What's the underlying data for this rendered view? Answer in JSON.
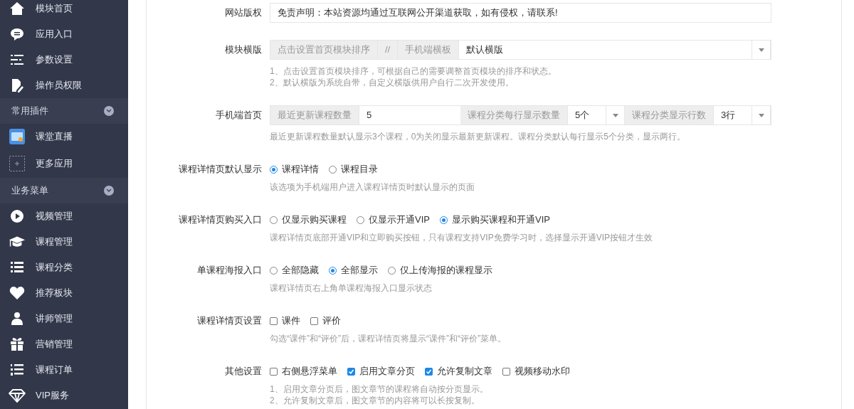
{
  "sidebar": [
    {
      "kind": "item",
      "label": "模块首页"
    },
    {
      "kind": "item",
      "label": "应用入口"
    },
    {
      "kind": "item",
      "label": "参数设置"
    },
    {
      "kind": "item",
      "label": "操作员权限"
    },
    {
      "kind": "section",
      "label": "常用插件",
      "expanded": true
    },
    {
      "kind": "item",
      "label": "课堂直播"
    },
    {
      "kind": "item",
      "label": "更多应用"
    },
    {
      "kind": "section",
      "label": "业务菜单",
      "expanded": true
    },
    {
      "kind": "item",
      "label": "视频管理"
    },
    {
      "kind": "item",
      "label": "课程管理"
    },
    {
      "kind": "item",
      "label": "课程分类"
    },
    {
      "kind": "item",
      "label": "推荐板块"
    },
    {
      "kind": "item",
      "label": "讲师管理"
    },
    {
      "kind": "item",
      "label": "营销管理"
    },
    {
      "kind": "item",
      "label": "课程订单"
    },
    {
      "kind": "item",
      "label": "VIP服务"
    }
  ],
  "form": [
    {
      "label": "网站版权",
      "controls": [
        {
          "kind": "text",
          "value": "免责声明：本站资源均通过互联网公开渠道获取，如有侵权，请联系!"
        }
      ]
    },
    {
      "label": "模块横版",
      "controls": [
        {
          "kind": "addon",
          "text": "点击设置首页模块排序"
        },
        {
          "kind": "addon",
          "text": "//"
        },
        {
          "kind": "addon",
          "text": "手机端横板"
        },
        {
          "kind": "select",
          "value": "默认横版"
        }
      ],
      "help": [
        "1、点击设置首页模块排序，可根据自己的需要调整首页模块的排序和状态。",
        "2、默认横版为系统自带，自定义横版供用户自行二次开发使用。"
      ]
    },
    {
      "label": "手机端首页",
      "controls": [
        {
          "kind": "addon",
          "text": "最近更新课程数量"
        },
        {
          "kind": "text",
          "value": "5"
        },
        {
          "kind": "addon",
          "text": "课程分类每行显示数量"
        },
        {
          "kind": "select",
          "value": "5个"
        },
        {
          "kind": "addon",
          "text": "课程分类显示行数"
        },
        {
          "kind": "select",
          "value": "3行"
        }
      ],
      "help": [
        "最近更新课程数量默认显示3个课程，0为关闭显示最新更新课程。课程分类默认每行显示5个分类，显示两行。"
      ]
    },
    {
      "label": "课程详情页默认显示",
      "controls": [
        {
          "kind": "radio",
          "text": "课程详情",
          "selected": true
        },
        {
          "kind": "radio",
          "text": "课程目录",
          "selected": false
        }
      ],
      "help": [
        "该选项为手机端用户进入课程详情页时默认显示的页面"
      ]
    },
    {
      "label": "课程详情页购买入口",
      "controls": [
        {
          "kind": "radio",
          "text": "仅显示购买课程",
          "selected": false
        },
        {
          "kind": "radio",
          "text": "仅显示开通VIP",
          "selected": false
        },
        {
          "kind": "radio",
          "text": "显示购买课程和开通VIP",
          "selected": true
        }
      ],
      "help": [
        "课程详情页底部开通VIP和立即购买按钮，只有课程支持VIP免费学习时，选择显示开通VIP按钮才生效"
      ]
    },
    {
      "label": "单课程海报入口",
      "controls": [
        {
          "kind": "radio",
          "text": "全部隐藏",
          "selected": false
        },
        {
          "kind": "radio",
          "text": "全部显示",
          "selected": true
        },
        {
          "kind": "radio",
          "text": "仅上传海报的课程显示",
          "selected": false
        }
      ],
      "help": [
        "课程详情页右上角单课程海报入口显示状态"
      ]
    },
    {
      "label": "课程详情页设置",
      "controls": [
        {
          "kind": "checkbox",
          "text": "课件",
          "checked": false
        },
        {
          "kind": "checkbox",
          "text": "评价",
          "checked": false
        }
      ],
      "help": [
        "勾选“课件”和“评价”后，课程详情页将显示“课件”和“评价”菜单。"
      ]
    },
    {
      "label": "其他设置",
      "controls": [
        {
          "kind": "checkbox",
          "text": "右侧悬浮菜单",
          "checked": false
        },
        {
          "kind": "checkbox",
          "text": "启用文章分页",
          "checked": true
        },
        {
          "kind": "checkbox",
          "text": "允许复制文章",
          "checked": true
        },
        {
          "kind": "checkbox",
          "text": "视频移动水印",
          "checked": false
        }
      ],
      "help": [
        "1、启用文章分页后，图文章节的课程将自动按分页显示。",
        "2、允许复制文章后，图文章节的内容将可以长按复制。"
      ]
    }
  ]
}
